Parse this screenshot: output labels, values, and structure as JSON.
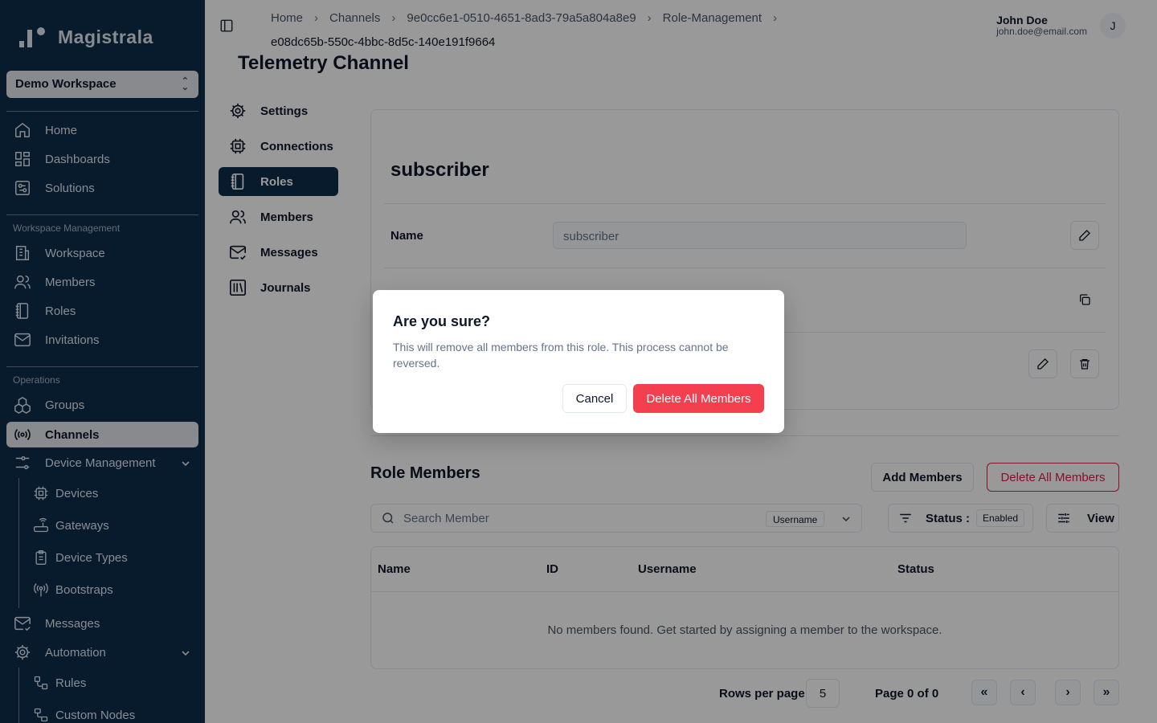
{
  "app": {
    "name": "Magistrala"
  },
  "workspace": {
    "selected": "Demo Workspace"
  },
  "sidebar": {
    "top_items": [
      {
        "label": "Home",
        "icon": "home-icon"
      },
      {
        "label": "Dashboards",
        "icon": "dashboards-icon"
      },
      {
        "label": "Solutions",
        "icon": "solutions-icon"
      }
    ],
    "workspace_section": "Workspace Management",
    "workspace_items": [
      {
        "label": "Workspace",
        "icon": "building-icon"
      },
      {
        "label": "Members",
        "icon": "users-icon"
      },
      {
        "label": "Roles",
        "icon": "notebook-icon"
      },
      {
        "label": "Invitations",
        "icon": "mail-icon"
      }
    ],
    "operations_section": "Operations",
    "operations_items": [
      {
        "label": "Groups",
        "icon": "groups-icon"
      },
      {
        "label": "Channels",
        "icon": "radio-icon",
        "active": true
      },
      {
        "label": "Device Management",
        "icon": "sliders-icon",
        "expanded": true
      }
    ],
    "device_items": [
      {
        "label": "Devices",
        "icon": "cpu-icon"
      },
      {
        "label": "Gateways",
        "icon": "router-icon"
      },
      {
        "label": "Device Types",
        "icon": "clipboard-icon"
      },
      {
        "label": "Bootstraps",
        "icon": "antenna-icon"
      }
    ],
    "after_items": [
      {
        "label": "Messages",
        "icon": "mail-check-icon"
      },
      {
        "label": "Automation",
        "icon": "gear-icon",
        "expanded": true
      }
    ],
    "automation_items": [
      {
        "label": "Rules",
        "icon": "workflow-icon"
      },
      {
        "label": "Custom Nodes",
        "icon": "nodes-icon"
      }
    ]
  },
  "header": {
    "breadcrumb": [
      "Home",
      "Channels",
      "9e0cc6e1-0510-4651-8ad3-79a5a804a8e9",
      "Role-Management",
      "e08dc65b-550c-4bbc-8d5c-140e191f9664"
    ],
    "user_name": "John Doe",
    "user_email": "john.doe@email.com",
    "avatar_initial": "J"
  },
  "page": {
    "title": "Telemetry Channel"
  },
  "subnav": [
    {
      "label": "Settings",
      "icon": "gear-icon"
    },
    {
      "label": "Connections",
      "icon": "cpu-icon"
    },
    {
      "label": "Roles",
      "icon": "notebook-icon",
      "active": true
    },
    {
      "label": "Members",
      "icon": "users-icon"
    },
    {
      "label": "Messages",
      "icon": "mail-check-icon"
    },
    {
      "label": "Journals",
      "icon": "library-icon"
    }
  ],
  "role": {
    "title": "subscriber",
    "name_label": "Name",
    "name_value": "subscriber"
  },
  "members": {
    "title": "Role Members",
    "add_button": "Add Members",
    "delete_all_button": "Delete All Members",
    "search_placeholder": "Search Member",
    "search_field": "Username",
    "status_label": "Status :",
    "status_value": "Enabled",
    "view_button": "View",
    "columns": [
      "Name",
      "ID",
      "Username",
      "Status"
    ],
    "empty_message": "No members found. Get started by assigning a member to the workspace.",
    "rows_per_page_label": "Rows per page",
    "rows_per_page": "5",
    "page_info": "Page 0 of 0"
  },
  "dialog": {
    "title": "Are you sure?",
    "text": "This will remove all members from this role. This process cannot be reversed.",
    "cancel": "Cancel",
    "confirm": "Delete All Members"
  },
  "colors": {
    "sidebar": "#0d2d4c",
    "danger": "#f43f4e",
    "active_bg": "#e5e7eb"
  }
}
